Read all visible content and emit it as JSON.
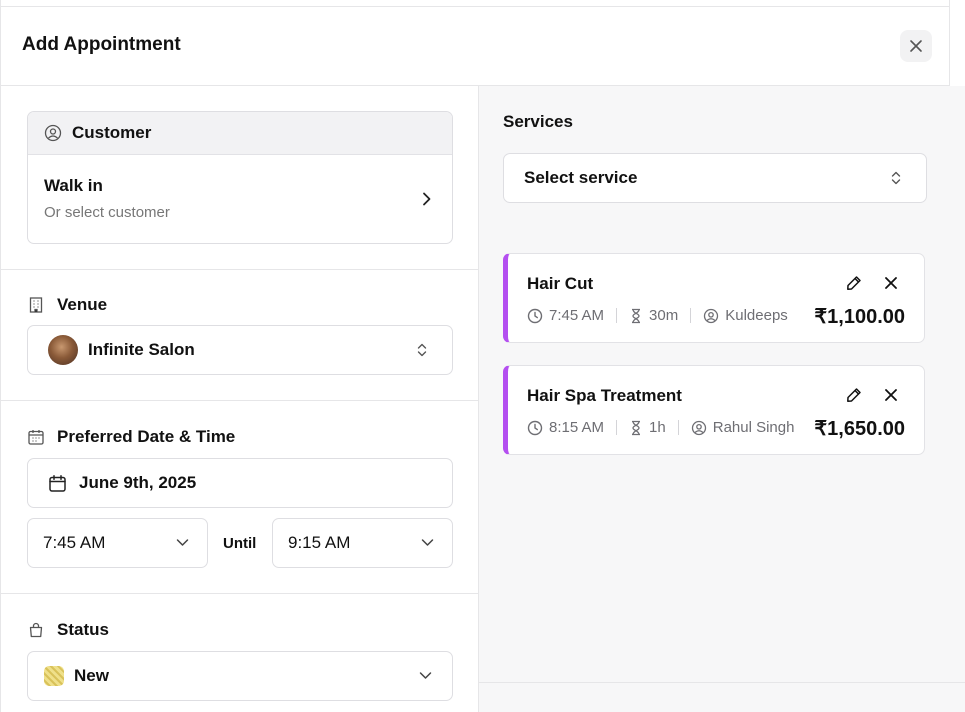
{
  "modal": {
    "title": "Add Appointment"
  },
  "customer": {
    "header": "Customer",
    "name": "Walk in",
    "hint": "Or select customer"
  },
  "venue": {
    "label": "Venue",
    "value": "Infinite Salon"
  },
  "datetime": {
    "label": "Preferred Date & Time",
    "date": "June 9th, 2025",
    "start": "7:45 AM",
    "until": "Until",
    "end": "9:15 AM"
  },
  "status": {
    "label": "Status",
    "value": "New",
    "color": "#e6d16a"
  },
  "services": {
    "label": "Services",
    "select_placeholder": "Select service",
    "accent": "#b44ff0",
    "items": [
      {
        "name": "Hair Cut",
        "time": "7:45 AM",
        "duration": "30m",
        "staff": "Kuldeeps",
        "price": "₹1,100.00"
      },
      {
        "name": "Hair Spa Treatment",
        "time": "8:15 AM",
        "duration": "1h",
        "staff": "Rahul Singh",
        "price": "₹1,650.00"
      }
    ]
  }
}
